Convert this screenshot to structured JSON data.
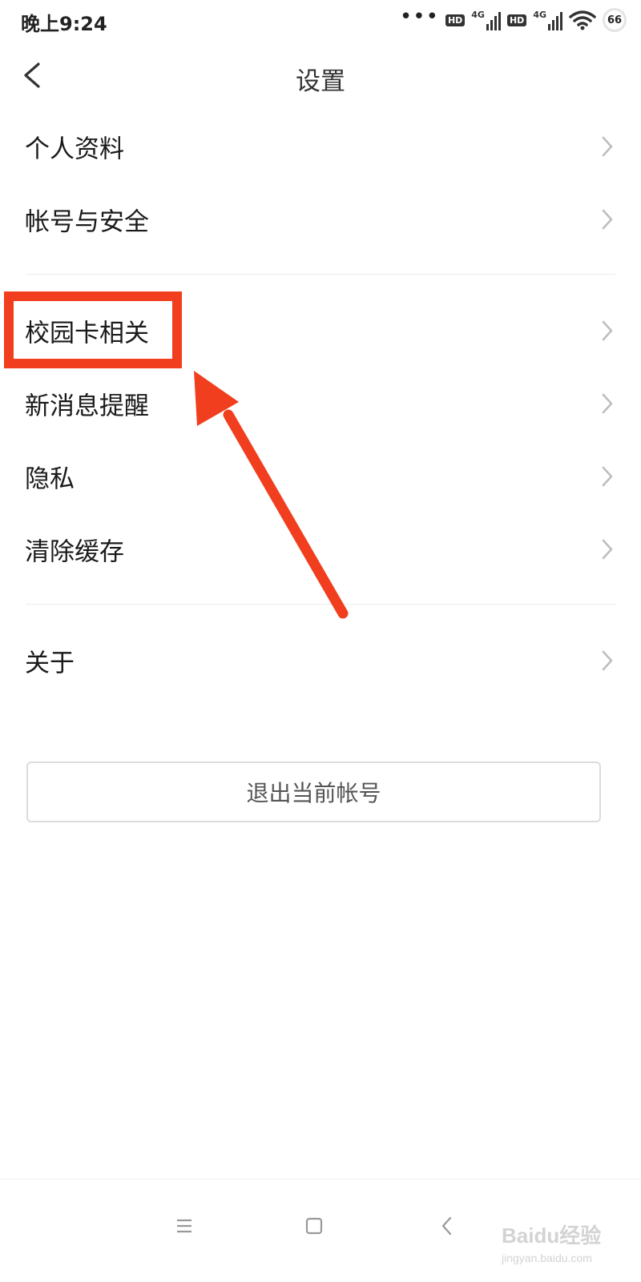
{
  "status_bar": {
    "time": "晚上9:24",
    "hd_label": "HD",
    "network_label": "4G",
    "battery_level": "66"
  },
  "header": {
    "title": "设置"
  },
  "settings_groups": [
    {
      "items": [
        {
          "label": "个人资料"
        },
        {
          "label": "帐号与安全"
        }
      ]
    },
    {
      "items": [
        {
          "label": "校园卡相关",
          "highlighted": true
        },
        {
          "label": "新消息提醒"
        },
        {
          "label": "隐私"
        },
        {
          "label": "清除缓存"
        }
      ]
    },
    {
      "items": [
        {
          "label": "关于"
        }
      ]
    }
  ],
  "logout_button": {
    "label": "退出当前帐号"
  },
  "annotation": {
    "color": "#f03e1e"
  },
  "icons": {
    "back": "chevron-left-icon",
    "row_arrow": "chevron-right-icon",
    "nav_menu": "menu-icon",
    "nav_home": "home-square-icon",
    "nav_back": "back-arrow-icon"
  },
  "watermark": {
    "brand": "Baidu经验",
    "url": "jingyan.baidu.com"
  }
}
